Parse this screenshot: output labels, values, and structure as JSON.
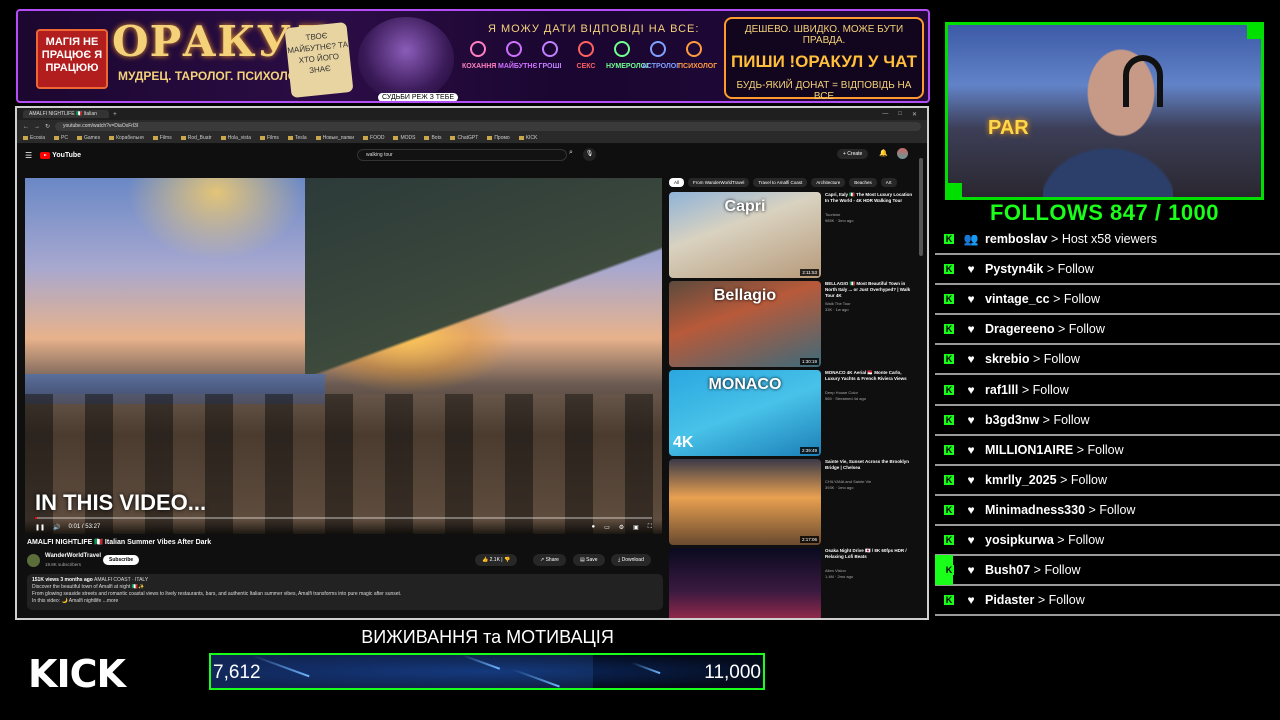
{
  "banner": {
    "magic_text": "МАГІЯ НЕ ПРАЦЮЄ Я ПРАЦЮЮ",
    "title": "ОРАКУЛ",
    "subtitle": "МУДРЕЦ. ТАРОЛОГ. ПСИХОЛОГ.",
    "sign_text": "ТВОЄ МАЙБУТНЄ? ТА ХТО ЙОГО ЗНАЄ",
    "bubble_text": "СУДЬБИ РЕЖ З ТЕБЕ",
    "answers_text": "Я МОЖУ ДАТИ ВІДПОВІДІ НА ВСЕ:",
    "categories": [
      "КОХАННЯ",
      "МАЙБУТНЄ",
      "ГРОШІ",
      "СЕКС",
      "НУМЕРОЛОГ",
      "АСТРОЛОГ",
      "ПСИХОЛОГ"
    ],
    "cta_line1": "ДЕШЕВО. ШВИДКО. МОЖЕ БУТИ ПРАВДА.",
    "cta_line2": "ПИШИ !ОРАКУЛ У ЧАТ",
    "cta_line3": "БУДЬ-ЯКИЙ ДОНАТ = ВІДПОВІДЬ НА ВСЕ"
  },
  "browser": {
    "tab_title": "AMALFI NIGHTLIFE 🇮🇹 Italian",
    "url": "youtube.com/watch?v=DiaOxFrl3I",
    "bookmarks": [
      "Ecosia",
      "PC",
      "Games",
      "Корабельня",
      "Films",
      "Rod_Buatr",
      "Hola_vista",
      "Films",
      "Tesla",
      "Новые_папки",
      "FOOD",
      "MODS",
      "Bots",
      "ChatGPT",
      "Промо",
      "KICK"
    ]
  },
  "youtube": {
    "logo_text": "YouTube",
    "search_value": "walking tour",
    "create_label": "+ Create",
    "player": {
      "overlay_text": "IN THIS VIDEO...",
      "time": "0:01 / 53:27",
      "progress": 0.003
    },
    "video_title": "AMALFI NIGHTLIFE 🇮🇹 Italian Summer Vibes After Dark",
    "channel_name": "WanderWorldTravel",
    "channel_subs": "19.8K subscribers",
    "subscribe_label": "Subscribe",
    "likes": "2.1K",
    "share_label": "Share",
    "save_label": "Save",
    "download_label": "Download",
    "desc_stats": "151K views 3 months ago",
    "desc_tags": "AMALFI COAST · ITALY",
    "desc_line1": "Discover the beautiful town of Amalfi at night 🇮🇹✨",
    "desc_line2": "From glowing seaside streets and romantic coastal views to lively restaurants, bars, and authentic Italian summer vibes, Amalfi transforms into pure magic after sunset.",
    "desc_line3": "In this video: 🌙 Amalfi nightlife ...more",
    "chips": [
      "All",
      "From WanderWorldTravel",
      "Travel to Amalfi Coast",
      "Architecture",
      "Beaches",
      "Art"
    ],
    "recommendations": [
      {
        "thumb_label": "Capri",
        "duration": "2:11:53",
        "title": "Capri, Italy 🇮🇹 The Most Luxury Location In The World - 4K HDR Walking Tour",
        "meta1": "Touristor",
        "meta2": "985K · 3mo ago"
      },
      {
        "thumb_label": "Bellagio",
        "duration": "1:30:19",
        "title": "BELLAGIO 🇮🇹 Most Beautiful Town in North Italy ... or Just Overhyped? | Walk Tour 4K",
        "meta1": "Walk The Tour",
        "meta2": "33K · 1w ago"
      },
      {
        "thumb_label": "MONACO",
        "badge": "4K",
        "duration": "2:39:49",
        "title": "MONACO 4K Aerial 🇲🇨 Monte Carlo, Luxury Yachts & French Riviera Views",
        "meta1": "Deep House Color",
        "meta2": "565 · Streamed 4d ago"
      },
      {
        "thumb_label": "",
        "duration": "2:17:06",
        "title": "Sainte Vie, Sunset Across the Brooklyn Bridge | Chelsea",
        "meta1": "CHILYANA and Sainte Vie",
        "meta2": "393K · 1mo ago"
      },
      {
        "thumb_label": "",
        "duration": "",
        "title": "Osaka Night Drive 🇯🇵 / 8K 60fps HDR / Relaxing Lofi Beats",
        "meta1": "Alien Vision",
        "meta2": "1.4M · 2mo ago"
      }
    ]
  },
  "cam": {
    "neon_text": "PAR"
  },
  "follows_text": "FOLLOWS 847 / 1000",
  "events": [
    {
      "icon": "host-icon",
      "user": "remboslav",
      "action": "Host x58 viewers",
      "highlight": false
    },
    {
      "icon": "heart-icon",
      "user": "Pystyn4ik",
      "action": "Follow",
      "highlight": false
    },
    {
      "icon": "heart-icon",
      "user": "vintage_cc",
      "action": "Follow",
      "highlight": false
    },
    {
      "icon": "heart-icon",
      "user": "Dragereeno",
      "action": "Follow",
      "highlight": false
    },
    {
      "icon": "heart-icon",
      "user": "skrebio",
      "action": "Follow",
      "highlight": false
    },
    {
      "icon": "heart-icon",
      "user": "raf1lll",
      "action": "Follow",
      "highlight": false
    },
    {
      "icon": "heart-icon",
      "user": "b3gd3nw",
      "action": "Follow",
      "highlight": false
    },
    {
      "icon": "heart-icon",
      "user": "MILLION1AIRE",
      "action": "Follow",
      "highlight": false
    },
    {
      "icon": "heart-icon",
      "user": "kmrlly_2025",
      "action": "Follow",
      "highlight": false
    },
    {
      "icon": "heart-icon",
      "user": "Minimadness330",
      "action": "Follow",
      "highlight": false
    },
    {
      "icon": "heart-icon",
      "user": "yosipkurwa",
      "action": "Follow",
      "highlight": false
    },
    {
      "icon": "heart-icon",
      "user": "Bush07",
      "action": "Follow",
      "highlight": true
    },
    {
      "icon": "heart-icon",
      "user": "Pidaster",
      "action": "Follow",
      "highlight": false
    }
  ],
  "event_separator": ">",
  "kick_logo": "KICK",
  "goal": {
    "title": "ВИЖИВАННЯ та МОТИВАЦІЯ",
    "current_label": "7,612",
    "target_label": "11,000",
    "current": 7612,
    "target": 11000
  },
  "colors": {
    "accent_green": "#19ff19",
    "banner_border": "#b44df5",
    "youtube_red": "#ff0000"
  }
}
